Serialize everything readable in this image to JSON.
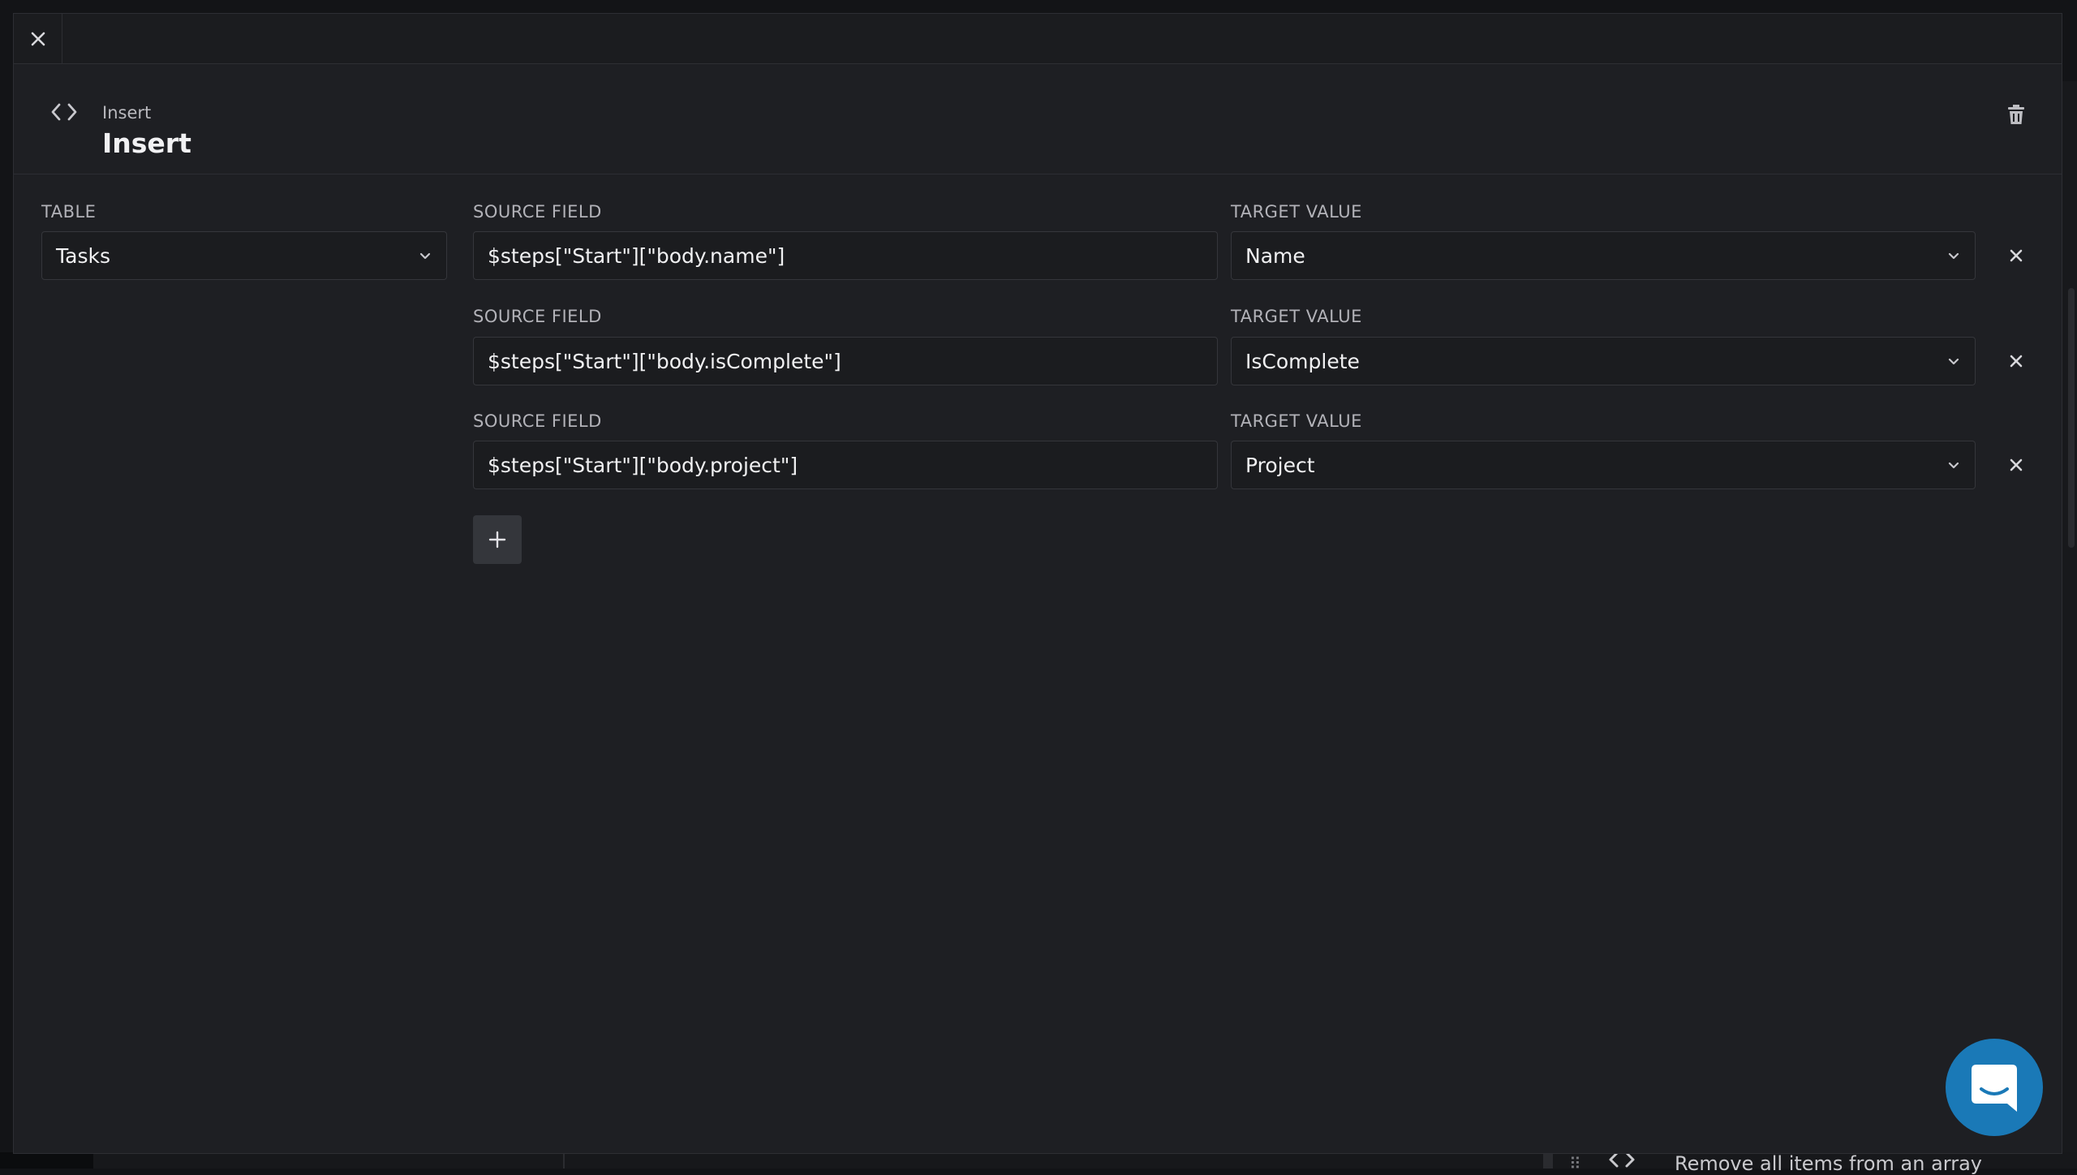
{
  "header": {
    "subtitle": "Insert",
    "title": "Insert"
  },
  "table": {
    "label": "TABLE",
    "value": "Tasks"
  },
  "mappings": [
    {
      "source_label": "SOURCE FIELD",
      "source_value": "$steps[\"Start\"][\"body.name\"]",
      "target_label": "TARGET VALUE",
      "target_value": "Name"
    },
    {
      "source_label": "SOURCE FIELD",
      "source_value": "$steps[\"Start\"][\"body.isComplete\"]",
      "target_label": "TARGET VALUE",
      "target_value": "IsComplete"
    },
    {
      "source_label": "SOURCE FIELD",
      "source_value": "$steps[\"Start\"][\"body.project\"]",
      "target_label": "TARGET VALUE",
      "target_value": "Project"
    }
  ],
  "background": {
    "peek_text": "Remove all items from an array"
  },
  "icons": {
    "close": "close-icon",
    "code": "code-icon",
    "trash": "trash-icon",
    "chevron": "chevron-down-icon",
    "add": "plus-icon",
    "chat": "chat-icon"
  },
  "colors": {
    "modal_bg": "#1e1f23",
    "input_bg": "#1b1c1f",
    "border": "#35363b",
    "chat_accent": "#1a79b7"
  }
}
